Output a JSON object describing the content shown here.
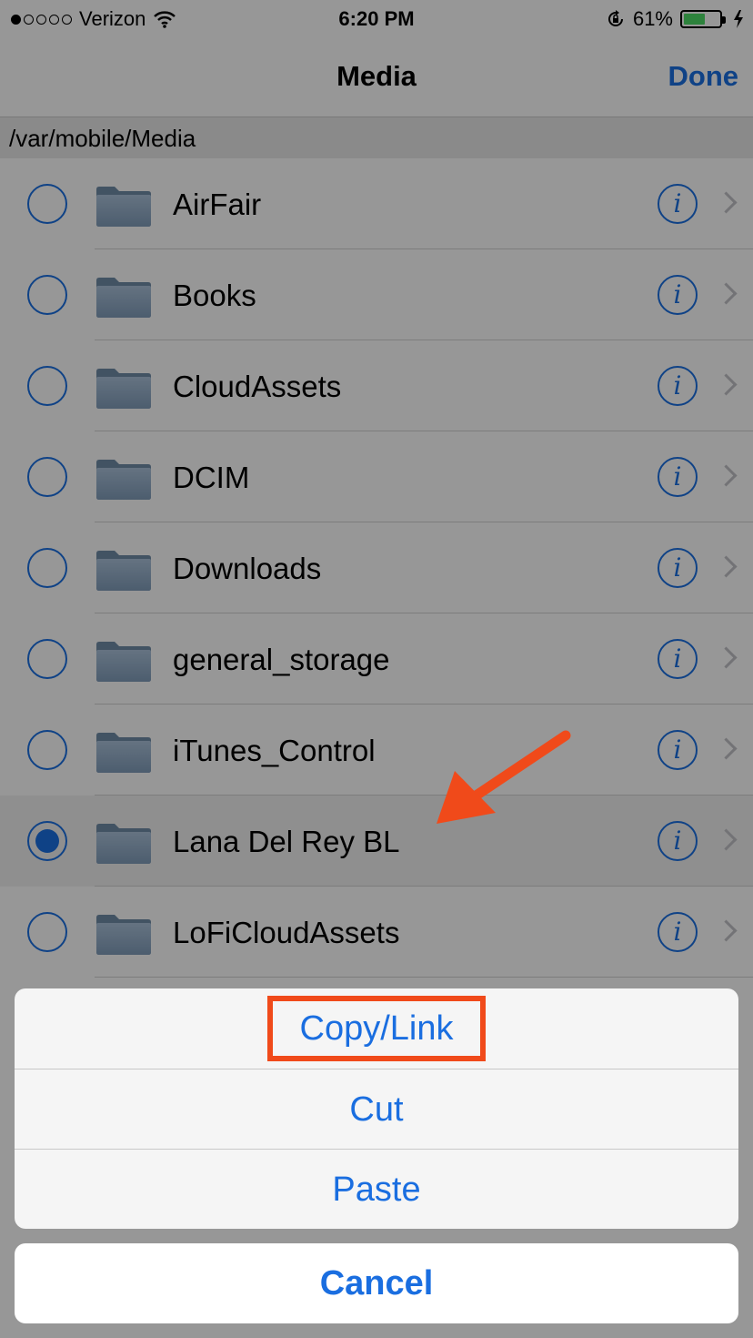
{
  "status_bar": {
    "carrier": "Verizon",
    "time": "6:20 PM",
    "battery_percent": "61%",
    "battery_level": 0.61,
    "signal_dots_full": 1,
    "signal_dots_total": 5,
    "icons": [
      "wifi-icon",
      "rotation-lock-icon",
      "battery-icon",
      "charging-bolt-icon"
    ]
  },
  "nav": {
    "title": "Media",
    "done_label": "Done"
  },
  "path": "/var/mobile/Media",
  "files": [
    {
      "name": "AirFair",
      "selected": false
    },
    {
      "name": "Books",
      "selected": false
    },
    {
      "name": "CloudAssets",
      "selected": false
    },
    {
      "name": "DCIM",
      "selected": false
    },
    {
      "name": "Downloads",
      "selected": false
    },
    {
      "name": "general_storage",
      "selected": false
    },
    {
      "name": "iTunes_Control",
      "selected": false
    },
    {
      "name": "Lana Del Rey BL",
      "selected": true
    },
    {
      "name": "LoFiCloudAssets",
      "selected": false
    }
  ],
  "row_icons": {
    "folder": "folder-icon",
    "info": "info-icon",
    "chevron": "chevron-right-icon",
    "info_glyph": "i"
  },
  "action_sheet": {
    "actions": [
      "Copy/Link",
      "Cut",
      "Paste"
    ],
    "cancel_label": "Cancel",
    "highlighted_action": "Copy/Link"
  },
  "colors": {
    "accent": "#1a6ee0",
    "annotation": "#f04a1a",
    "battery": "#4cd964"
  }
}
